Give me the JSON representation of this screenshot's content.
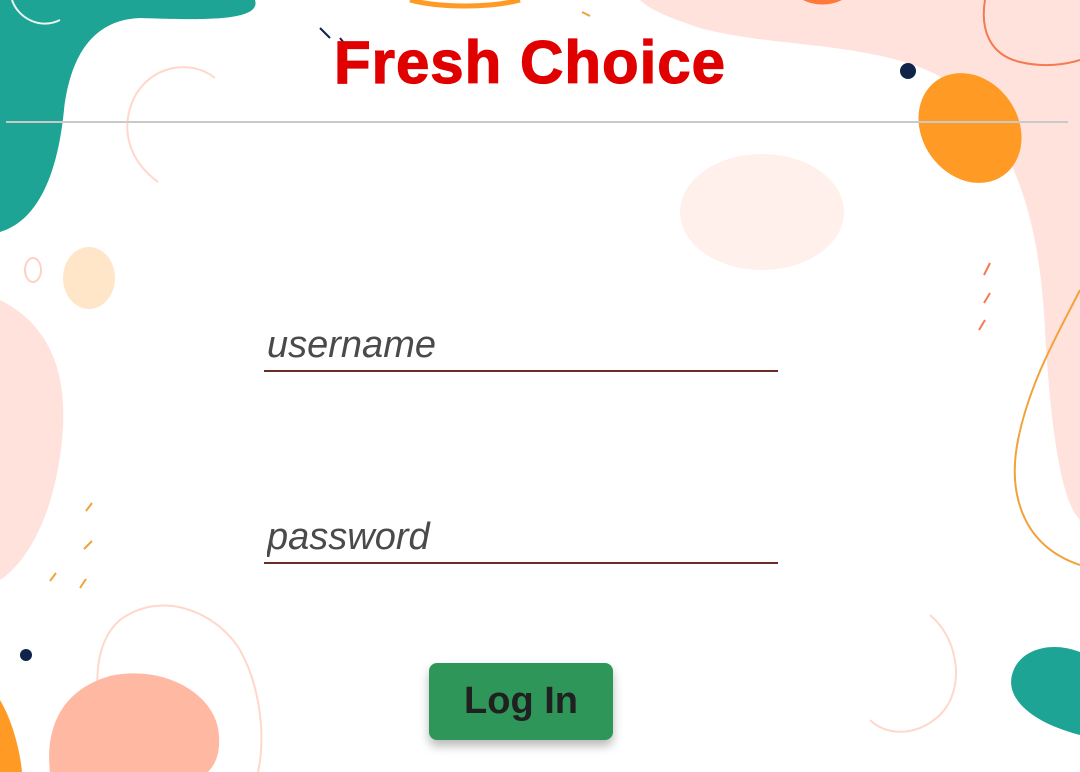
{
  "app": {
    "title": "Fresh Choice"
  },
  "form": {
    "username_placeholder": "username",
    "password_placeholder": "password",
    "login_label": "Log In"
  },
  "colors": {
    "title": "#e00000",
    "login_button": "#2e9659",
    "teal_blob": "#1ea494",
    "orange_blob": "#ff9a25",
    "peach_blob": "#ffb9a3",
    "pink_blob": "#ffe2dc"
  }
}
